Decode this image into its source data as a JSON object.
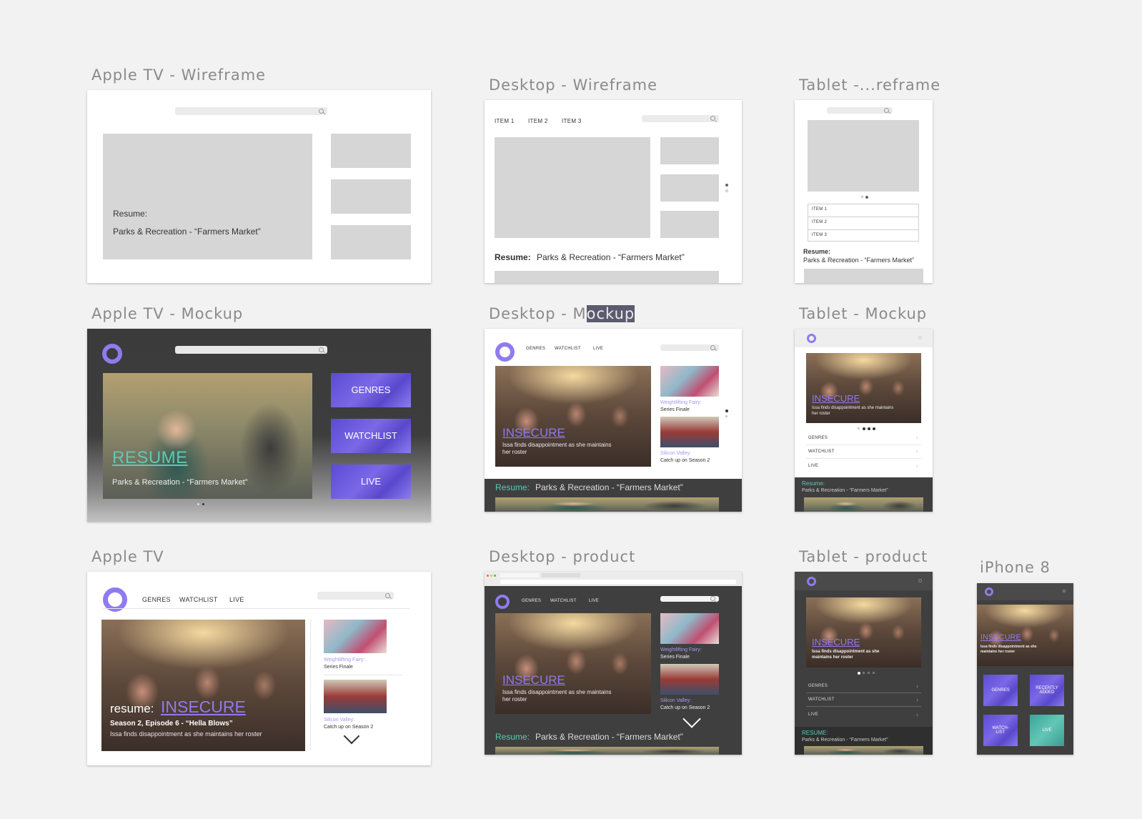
{
  "artboard_labels": {
    "atv_wire": "Apple TV - Wireframe",
    "desk_wire": "Desktop - Wireframe",
    "tab_wire": "Tablet -...reframe",
    "atv_mock": "Apple TV - Mockup",
    "desk_mock_a": "Desktop - M",
    "desk_mock_b": "ockup",
    "tab_mock": "Tablet - Mockup",
    "atv": "Apple TV",
    "desk_prod": "Desktop - product",
    "tab_prod": "Tablet - product",
    "iphone": "iPhone 8"
  },
  "atv_wire": {
    "resume_label": "Resume:",
    "resume_title": "Parks & Recreation - “Farmers Market”"
  },
  "desk_wire": {
    "nav": [
      "ITEM 1",
      "ITEM 2",
      "ITEM 3"
    ],
    "resume_label": "Resume:",
    "resume_title": "Parks & Recreation - “Farmers Market”"
  },
  "tab_wire": {
    "items": [
      "ITEM 1",
      "ITEM 2",
      "ITEM 3"
    ],
    "resume_label": "Resume:",
    "resume_title": "Parks & Recreation - “Farmers Market”"
  },
  "atv_mock": {
    "buttons": [
      "GENRES",
      "WATCHLIST",
      "LIVE"
    ],
    "resume_heading": "RESUME",
    "resume_title": "Parks & Recreation - “Farmers Market”"
  },
  "desk_mock": {
    "nav": [
      "GENRES",
      "WATCHLIST",
      "LIVE"
    ],
    "hero_title": "INSECURE",
    "hero_desc_1": "Issa finds disappointment as she maintains",
    "hero_desc_2": "her roster",
    "side1_title": "Weightlifting Fairy:",
    "side1_sub": "Series Finale",
    "side2_title": "Silicon Valley:",
    "side2_sub": "Catch up on Season 2",
    "resume_label": "Resume:",
    "resume_title": "Parks & Recreation - “Farmers Market”"
  },
  "tab_mock": {
    "hero_title": "INSECURE",
    "hero_desc_1": "Issa finds disappointment as she maintains",
    "hero_desc_2": "her roster",
    "menu": [
      "GENRES",
      "WATCHLIST",
      "LIVE"
    ],
    "resume_label": "Resume:",
    "resume_title": "Parks & Recreation - “Farmers Market”"
  },
  "atv": {
    "nav": [
      "GENRES",
      "WATCHLIST",
      "LIVE"
    ],
    "resume_word": "resume:",
    "hero_title": "INSECURE",
    "episode": "Season 2, Episode 6 - “Hella Blows”",
    "desc": "Issa finds disappointment as she maintains her roster",
    "side1_title": "Weightlifting Fairy:",
    "side1_sub": "Series Finale",
    "side2_title": "Silicon Valley:",
    "side2_sub": "Catch up on Season 2"
  },
  "desk_prod": {
    "nav": [
      "GENRES",
      "WATCHLIST",
      "LIVE"
    ],
    "hero_title": "INSECURE",
    "hero_desc_1": "Issa finds disappointment as she maintains",
    "hero_desc_2": "her roster",
    "side1_title": "Weightlifting Fairy:",
    "side1_sub": "Series Finale",
    "side2_title": "Silicon Valley:",
    "side2_sub": "Catch up on Season 2",
    "resume_label": "Resume:",
    "resume_title": "Parks & Recreation - “Farmers Market”"
  },
  "tab_prod": {
    "hero_title": "INSECURE",
    "hero_desc_1": "Issa finds disappointment as she",
    "hero_desc_2": "maintains her roster",
    "menu": [
      "GENRES",
      "WATCHLIST",
      "LIVE"
    ],
    "resume_label": "RESUME:",
    "resume_title": "Parks & Recreation - “Farmers Market”"
  },
  "iphone": {
    "hero_title": "INSECURE",
    "hero_desc_1": "Issa finds disappointment as she",
    "hero_desc_2": "maintains her roster",
    "tiles": [
      "GENRES",
      "RECENTLY ADDED",
      "WATCH-LIST",
      "LIVE"
    ]
  },
  "colors": {
    "accent_purple": "#7a68e6",
    "accent_teal": "#5fc8b4",
    "dark_bg": "#3f3f3f",
    "canvas": "#f2f2f2"
  }
}
